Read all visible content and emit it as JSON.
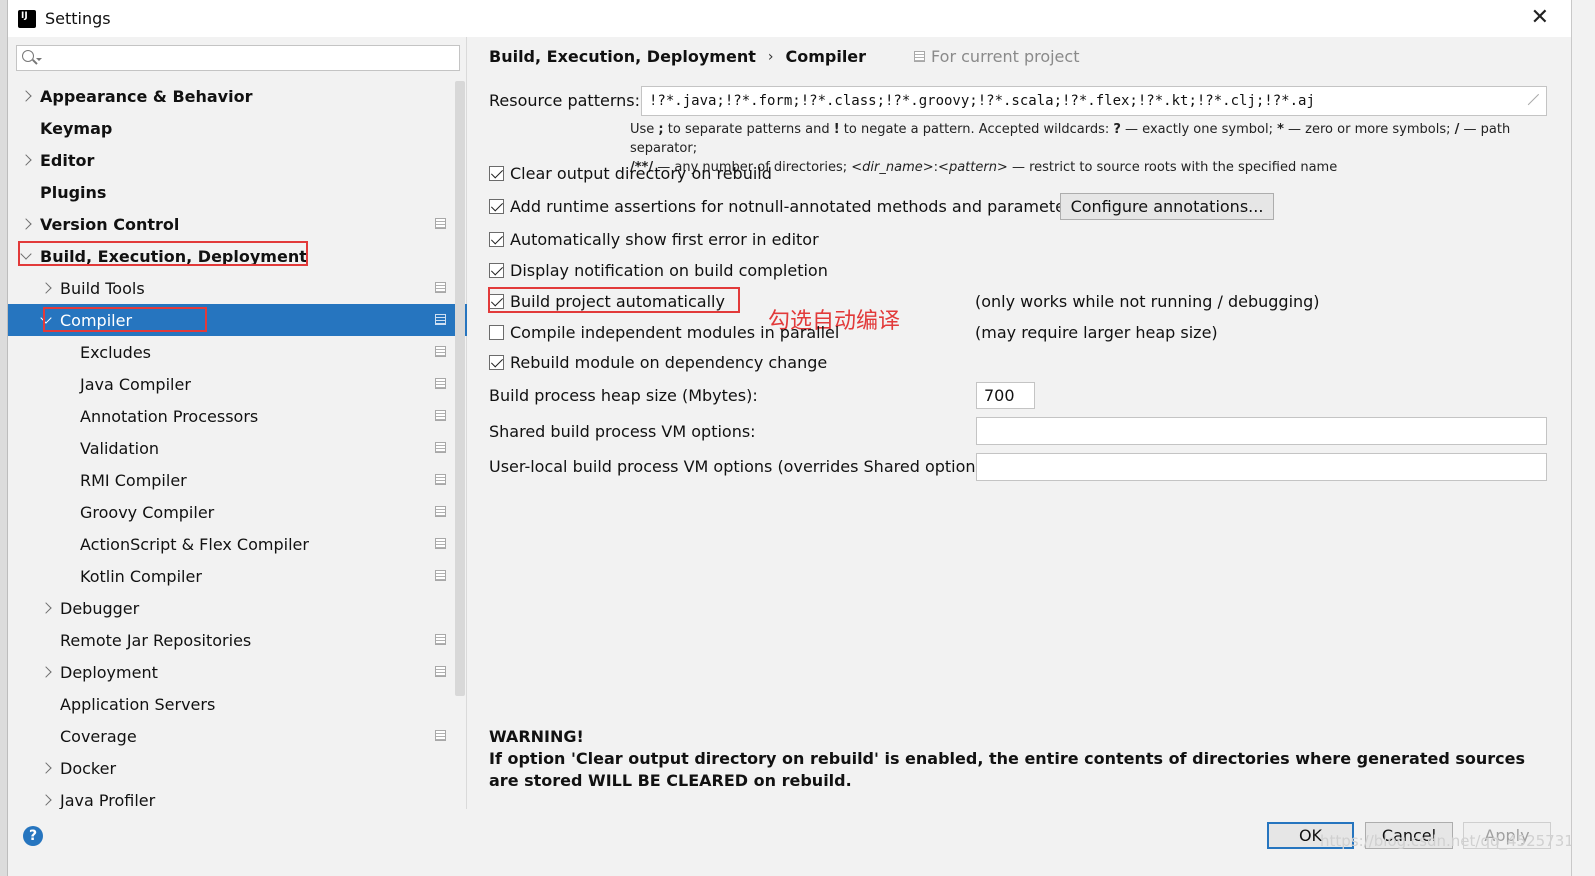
{
  "window": {
    "title": "Settings",
    "close_glyph": "✕"
  },
  "search": {
    "value": "",
    "placeholder": ""
  },
  "sidebar": {
    "items": [
      {
        "label": "Appearance & Behavior",
        "level": 0,
        "bold": true,
        "chevron": "right",
        "project_icon": false
      },
      {
        "label": "Keymap",
        "level": 0,
        "bold": true,
        "chevron": "none",
        "project_icon": false
      },
      {
        "label": "Editor",
        "level": 0,
        "bold": true,
        "chevron": "right",
        "project_icon": false
      },
      {
        "label": "Plugins",
        "level": 0,
        "bold": true,
        "chevron": "none",
        "project_icon": false
      },
      {
        "label": "Version Control",
        "level": 0,
        "bold": true,
        "chevron": "right",
        "project_icon": true
      },
      {
        "label": "Build, Execution, Deployment",
        "level": 0,
        "bold": true,
        "chevron": "down",
        "project_icon": false
      },
      {
        "label": "Build Tools",
        "level": 1,
        "bold": false,
        "chevron": "right",
        "project_icon": true
      },
      {
        "label": "Compiler",
        "level": 1,
        "bold": false,
        "chevron": "down",
        "project_icon": true,
        "selected": true
      },
      {
        "label": "Excludes",
        "level": 2,
        "bold": false,
        "chevron": "none",
        "project_icon": true
      },
      {
        "label": "Java Compiler",
        "level": 2,
        "bold": false,
        "chevron": "none",
        "project_icon": true
      },
      {
        "label": "Annotation Processors",
        "level": 2,
        "bold": false,
        "chevron": "none",
        "project_icon": true
      },
      {
        "label": "Validation",
        "level": 2,
        "bold": false,
        "chevron": "none",
        "project_icon": true
      },
      {
        "label": "RMI Compiler",
        "level": 2,
        "bold": false,
        "chevron": "none",
        "project_icon": true
      },
      {
        "label": "Groovy Compiler",
        "level": 2,
        "bold": false,
        "chevron": "none",
        "project_icon": true
      },
      {
        "label": "ActionScript & Flex Compiler",
        "level": 2,
        "bold": false,
        "chevron": "none",
        "project_icon": true
      },
      {
        "label": "Kotlin Compiler",
        "level": 2,
        "bold": false,
        "chevron": "none",
        "project_icon": true
      },
      {
        "label": "Debugger",
        "level": 1,
        "bold": false,
        "chevron": "right",
        "project_icon": false
      },
      {
        "label": "Remote Jar Repositories",
        "level": 1,
        "bold": false,
        "chevron": "none",
        "project_icon": true
      },
      {
        "label": "Deployment",
        "level": 1,
        "bold": false,
        "chevron": "right",
        "project_icon": true
      },
      {
        "label": "Application Servers",
        "level": 1,
        "bold": false,
        "chevron": "none",
        "project_icon": false
      },
      {
        "label": "Coverage",
        "level": 1,
        "bold": false,
        "chevron": "none",
        "project_icon": true
      },
      {
        "label": "Docker",
        "level": 1,
        "bold": false,
        "chevron": "right",
        "project_icon": false
      },
      {
        "label": "Java Profiler",
        "level": 1,
        "bold": false,
        "chevron": "right",
        "project_icon": false
      }
    ]
  },
  "breadcrumb": {
    "parent": "Build, Execution, Deployment",
    "separator": "›",
    "current": "Compiler",
    "scope": "For current project"
  },
  "resource_patterns": {
    "label": "Resource patterns:",
    "value": "!?*.java;!?*.form;!?*.class;!?*.groovy;!?*.scala;!?*.flex;!?*.kt;!?*.clj;!?*.aj"
  },
  "hint": {
    "t1": "Use ",
    "b1": ";",
    "t2": " to separate patterns and ",
    "b2": "!",
    "t3": " to negate a pattern. Accepted wildcards: ",
    "b3": "?",
    "t4": " — exactly one symbol; ",
    "b4": "*",
    "t5": " — zero or more symbols; ",
    "b5": "/",
    "t6": " — path separator;",
    "b6": "/**/",
    "t7": " — any number of directories; ",
    "i1": "<dir_name>",
    "t8": ":",
    "i2": "<pattern>",
    "t9": " — restrict to source roots with the specified name"
  },
  "options": {
    "clear_output": {
      "label": "Clear output directory on rebuild",
      "checked": true
    },
    "runtime_assertions": {
      "label": "Add runtime assertions for notnull-annotated methods and parameters",
      "checked": true
    },
    "configure_annotations": "Configure annotations...",
    "show_first_error": {
      "label": "Automatically show first error in editor",
      "checked": true
    },
    "display_notification": {
      "label": "Display notification on build completion",
      "checked": true
    },
    "build_automatically": {
      "label": "Build project automatically",
      "checked": true,
      "note": "(only works while not running / debugging)"
    },
    "compile_parallel": {
      "label": "Compile independent modules in parallel",
      "checked": false,
      "note": "(may require larger heap size)"
    },
    "rebuild_on_dependency": {
      "label": "Rebuild module on dependency change",
      "checked": true
    }
  },
  "heap": {
    "label": "Build process heap size (Mbytes):",
    "value": "700"
  },
  "shared_vm": {
    "label": "Shared build process VM options:",
    "value": ""
  },
  "user_vm": {
    "label": "User-local build process VM options (overrides Shared options):",
    "value": ""
  },
  "annotation_text": "勾选自动编译",
  "warning": {
    "title": "WARNING!",
    "body": "If option 'Clear output directory on rebuild' is enabled, the entire contents of directories where generated sources are stored WILL BE CLEARED on rebuild."
  },
  "buttons": {
    "ok": "OK",
    "cancel": "Cancel",
    "apply": "Apply",
    "help": "?"
  },
  "watermark": "https://blog.csdn.net/qq_45257319",
  "colors": {
    "selection": "#2675bf",
    "annotation_red": "#e23a3a",
    "background": "#f2f2f2"
  }
}
